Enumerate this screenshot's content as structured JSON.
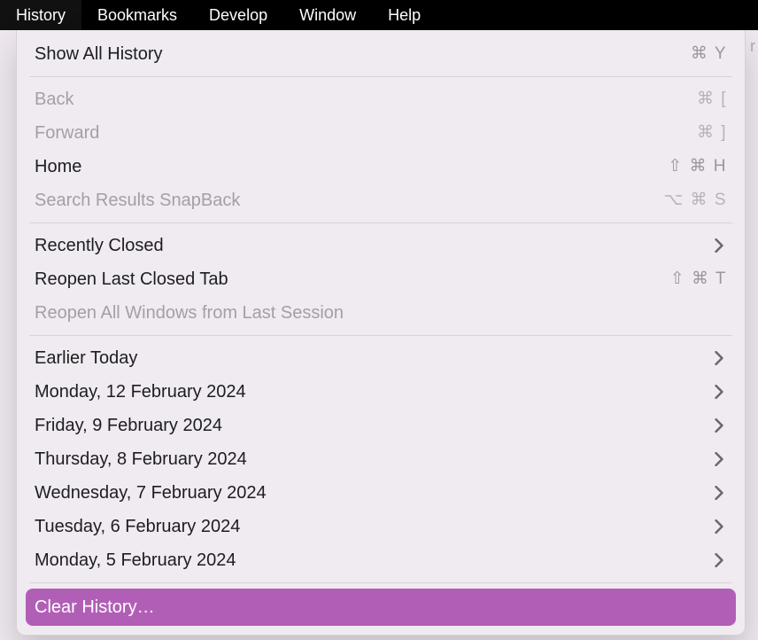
{
  "menubar": {
    "items": [
      "History",
      "Bookmarks",
      "Develop",
      "Window",
      "Help"
    ],
    "active_index": 0
  },
  "dropdown": {
    "sections": [
      [
        {
          "label": "Show All History",
          "shortcut": "⌘ Y",
          "enabled": true,
          "submenu": false
        }
      ],
      [
        {
          "label": "Back",
          "shortcut": "⌘ [",
          "enabled": false,
          "submenu": false
        },
        {
          "label": "Forward",
          "shortcut": "⌘ ]",
          "enabled": false,
          "submenu": false
        },
        {
          "label": "Home",
          "shortcut": "⇧ ⌘ H",
          "enabled": true,
          "submenu": false
        },
        {
          "label": "Search Results SnapBack",
          "shortcut": "⌥ ⌘ S",
          "enabled": false,
          "submenu": false
        }
      ],
      [
        {
          "label": "Recently Closed",
          "shortcut": "",
          "enabled": true,
          "submenu": true
        },
        {
          "label": "Reopen Last Closed Tab",
          "shortcut": "⇧ ⌘ T",
          "enabled": true,
          "submenu": false
        },
        {
          "label": "Reopen All Windows from Last Session",
          "shortcut": "",
          "enabled": false,
          "submenu": false
        }
      ],
      [
        {
          "label": "Earlier Today",
          "shortcut": "",
          "enabled": true,
          "submenu": true
        },
        {
          "label": "Monday, 12 February 2024",
          "shortcut": "",
          "enabled": true,
          "submenu": true
        },
        {
          "label": "Friday, 9 February 2024",
          "shortcut": "",
          "enabled": true,
          "submenu": true
        },
        {
          "label": "Thursday, 8 February 2024",
          "shortcut": "",
          "enabled": true,
          "submenu": true
        },
        {
          "label": "Wednesday, 7 February 2024",
          "shortcut": "",
          "enabled": true,
          "submenu": true
        },
        {
          "label": "Tuesday, 6 February 2024",
          "shortcut": "",
          "enabled": true,
          "submenu": true
        },
        {
          "label": "Monday, 5 February 2024",
          "shortcut": "",
          "enabled": true,
          "submenu": true
        }
      ],
      [
        {
          "label": "Clear History…",
          "shortcut": "",
          "enabled": true,
          "submenu": false,
          "highlight": true
        }
      ]
    ]
  },
  "side_edge_char": "r"
}
